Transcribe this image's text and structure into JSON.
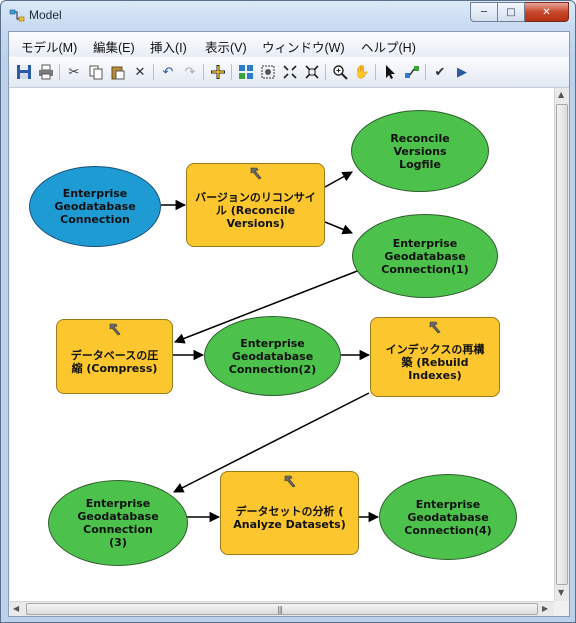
{
  "window": {
    "title": "Model",
    "buttons": {
      "minimize": "─",
      "maximize": "□",
      "close": "✕"
    }
  },
  "menu": [
    "モデル(M)",
    "編集(E)",
    "挿入(I)",
    "表示(V)",
    "ウィンドウ(W)",
    "ヘルプ(H)"
  ],
  "toolbar": {
    "icons": [
      "save-icon",
      "print-icon",
      "cut-icon",
      "copy-icon",
      "paste-icon",
      "delete-icon",
      "undo-icon",
      "redo-icon",
      "add-data-icon",
      "auto-layout-icon",
      "full-extent-icon",
      "zoom-in-fixed-icon",
      "zoom-out-fixed-icon",
      "zoom-in-icon",
      "pan-icon",
      "select-icon",
      "connect-icon",
      "validate-icon",
      "run-icon"
    ]
  },
  "nodes": {
    "input": "Enterprise\nGeodatabase\nConnection",
    "reconcile": "バージョンのリコンサイ\nル (Reconcile\nVersions)",
    "logfile": "Reconcile\nVersions\nLogfile",
    "conn1": "Enterprise\nGeodatabase\nConnection(1)",
    "compress": "データベースの圧\n縮 (Compress)",
    "conn2": "Enterprise\nGeodatabase\nConnection(2)",
    "rebuild": "インデックスの再構\n築 (Rebuild\nIndexes)",
    "conn3": "Enterprise\nGeodatabase\nConnection\n(3)",
    "analyze": "データセットの分析 (\nAnalyze Datasets)",
    "conn4": "Enterprise\nGeodatabase\nConnection(4)"
  },
  "colors": {
    "data_variable": "#4cc14c",
    "input_variable": "#1e9bd3",
    "tool": "#fbc62e"
  }
}
